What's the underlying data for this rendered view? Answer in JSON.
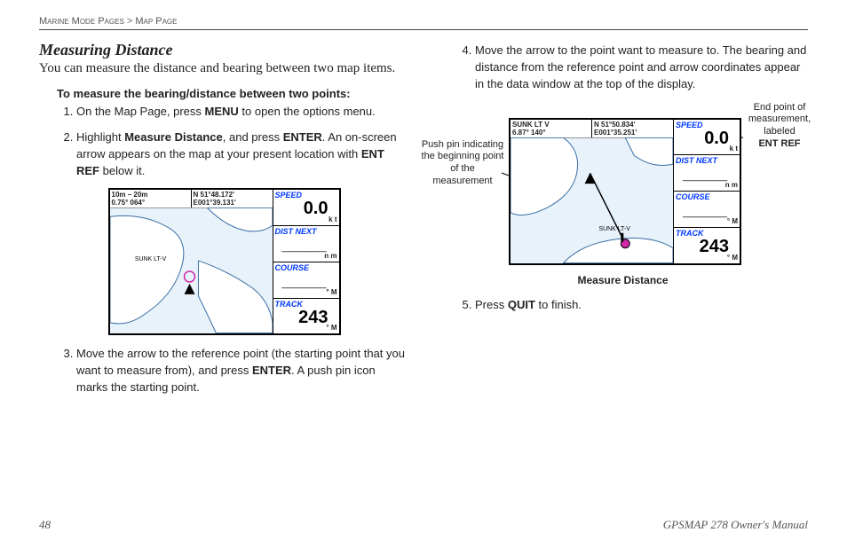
{
  "breadcrumb": {
    "a": "Marine Mode Pages",
    "sep": ">",
    "b": "Map Page"
  },
  "section_title": "Measuring Distance",
  "lead": "You can measure the distance and bearing between two map items.",
  "howto": "To measure the bearing/distance between two points:",
  "steps": {
    "s1a": "On the Map Page, press ",
    "s1b": "MENU",
    "s1c": " to open the options menu.",
    "s2a": "Highlight ",
    "s2b": "Measure Distance",
    "s2c": ", and press ",
    "s2d": "ENTER",
    "s2e": ". An on-screen arrow appears on the map at your present location with ",
    "s2f": "ENT REF",
    "s2g": " below it.",
    "s3a": "Move the arrow to the reference point (the starting point that you want to measure from), and press ",
    "s3b": "ENTER",
    "s3c": ". A push pin icon marks the starting point.",
    "s4": "Move the arrow to the point want to measure to. The bearing and distance from the reference point and arrow coordinates appear in the data window at the top of the display.",
    "s5a": "Press ",
    "s5b": "QUIT",
    "s5c": " to finish."
  },
  "device1": {
    "tb_left_a": "10m – 20m",
    "tb_left_b": "0.75°  064°",
    "tb_right_a": "N  51°48.172'",
    "tb_right_b": "E001°39.131'",
    "labels": {
      "speed": "SPEED",
      "dist": "DIST NEXT",
      "course": "COURSE",
      "track": "TRACK"
    },
    "speed_val": "0.0",
    "speed_unit": "k\nt",
    "dist_val": "_____",
    "dist_unit": "n\nm",
    "course_val": "_____",
    "course_unit": "°\nM",
    "track_val": "243",
    "track_unit": "°\nM",
    "sunk": "SUNK LT-V"
  },
  "device2": {
    "tb_left_a": "SUNK LT V",
    "tb_left_b": "6.87°  140°",
    "tb_right_a": "N  51°50.834'",
    "tb_right_b": "E001°35.251'",
    "labels": {
      "speed": "SPEED",
      "dist": "DIST NEXT",
      "course": "COURSE",
      "track": "TRACK"
    },
    "speed_val": "0.0",
    "speed_unit": "k\nt",
    "dist_val": "_____",
    "dist_unit": "n\nm",
    "course_val": "_____",
    "course_unit": "°\nM",
    "track_val": "243",
    "track_unit": "°\nM",
    "sunk": "SUNK LT-V"
  },
  "caption2": "Measure Distance",
  "annot_left_a": "Push pin indicating the beginning point of the measurement",
  "annot_right_a": "End point of measurement, labeled",
  "annot_right_b": "ENT REF",
  "footer": {
    "page": "48",
    "manual": "GPSMAP 278 Owner's Manual"
  }
}
